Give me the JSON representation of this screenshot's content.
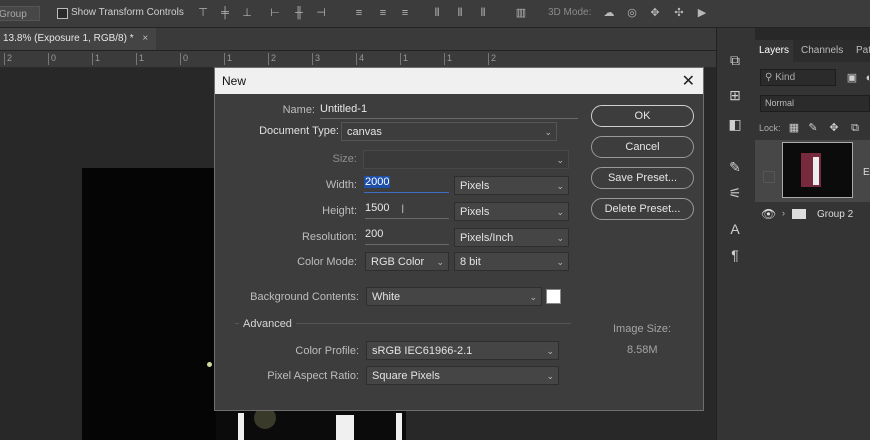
{
  "options_bar": {
    "auto_select_value": "Group",
    "show_transform_label": "Show Transform Controls",
    "mode3d_label": "3D Mode:"
  },
  "document_tab": {
    "title": "13.8% (Exposure 1, RGB/8) *",
    "close": "×"
  },
  "ruler": {
    "ticks": [
      "2",
      "0",
      "1",
      "1",
      "0",
      "1",
      "2",
      "3",
      "4",
      "1",
      "1",
      "2"
    ]
  },
  "layers_panel": {
    "tabs": [
      "Layers",
      "Channels",
      "Pat"
    ],
    "kind_label": "Kind",
    "blend_mode": "Normal",
    "lock_label": "Lock:",
    "layer_label_partial": "Ex",
    "group_label": "Group 2"
  },
  "dialog": {
    "title": "New",
    "close": "✕",
    "name_label": "Name:",
    "name_value": "Untitled-1",
    "doctype_label": "Document Type:",
    "doctype_value": "canvas",
    "size_label": "Size:",
    "width_label": "Width:",
    "width_value": "2000",
    "width_unit": "Pixels",
    "height_label": "Height:",
    "height_value": "1500",
    "height_unit": "Pixels",
    "resolution_label": "Resolution:",
    "resolution_value": "200",
    "resolution_unit": "Pixels/Inch",
    "colormode_label": "Color Mode:",
    "colormode_value": "RGB Color",
    "bitdepth_value": "8 bit",
    "bg_label": "Background Contents:",
    "bg_value": "White",
    "advanced_label": "Advanced",
    "profile_label": "Color Profile:",
    "profile_value": "sRGB IEC61966-2.1",
    "aspect_label": "Pixel Aspect Ratio:",
    "aspect_value": "Square Pixels",
    "buttons": {
      "ok": "OK",
      "cancel": "Cancel",
      "save_preset": "Save Preset...",
      "delete_preset": "Delete Preset..."
    },
    "image_size_label": "Image Size:",
    "image_size_value": "8.58M"
  },
  "colors": {
    "accent_selection": "#1e4fa8",
    "dialog_bg": "#3d3d3d",
    "panel_bg": "#343434"
  }
}
